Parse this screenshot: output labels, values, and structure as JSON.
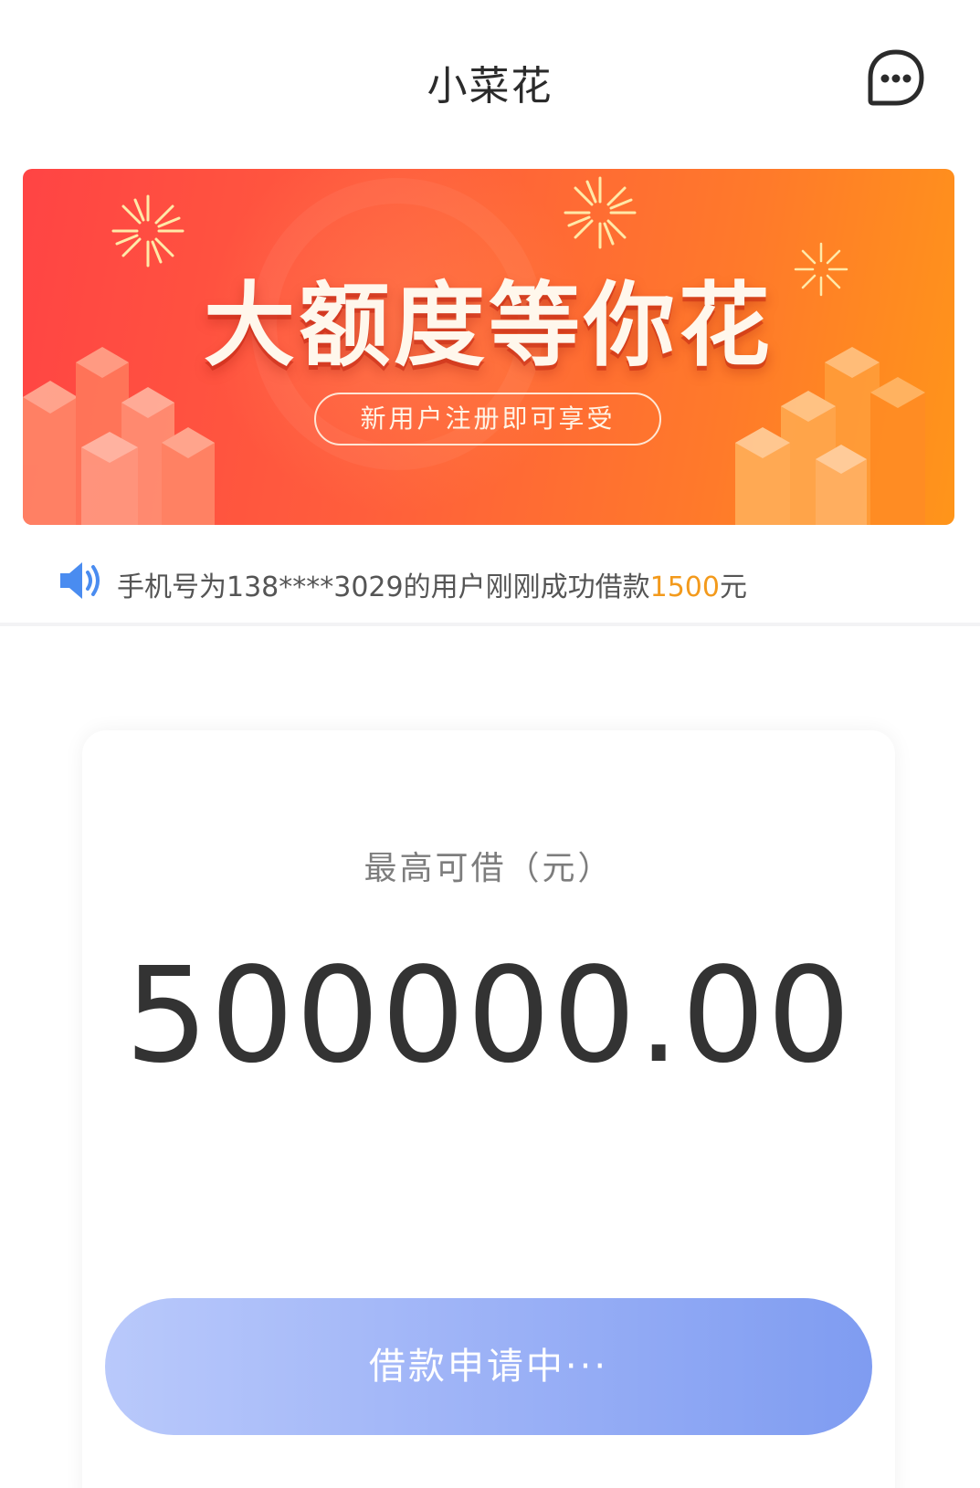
{
  "header": {
    "title": "小菜花",
    "chat_icon": "chat-bubble-ellipsis-icon"
  },
  "banner": {
    "headline": "大额度等你花",
    "subtitle": "新用户注册即可享受",
    "colors": {
      "from": "#ff4444",
      "to": "#ff951a"
    }
  },
  "notice": {
    "icon": "speaker-icon",
    "text_prefix": "手机号为138****3029的用户刚刚成功借款",
    "amount": "1500",
    "unit": "元",
    "amount_color": "#f39a1c"
  },
  "credit": {
    "label": "最高可借（元）",
    "amount": "500000.00"
  },
  "apply_button": {
    "label": "借款申请中···",
    "colors": {
      "from": "#b9c9fb",
      "to": "#7f9cf1"
    }
  }
}
